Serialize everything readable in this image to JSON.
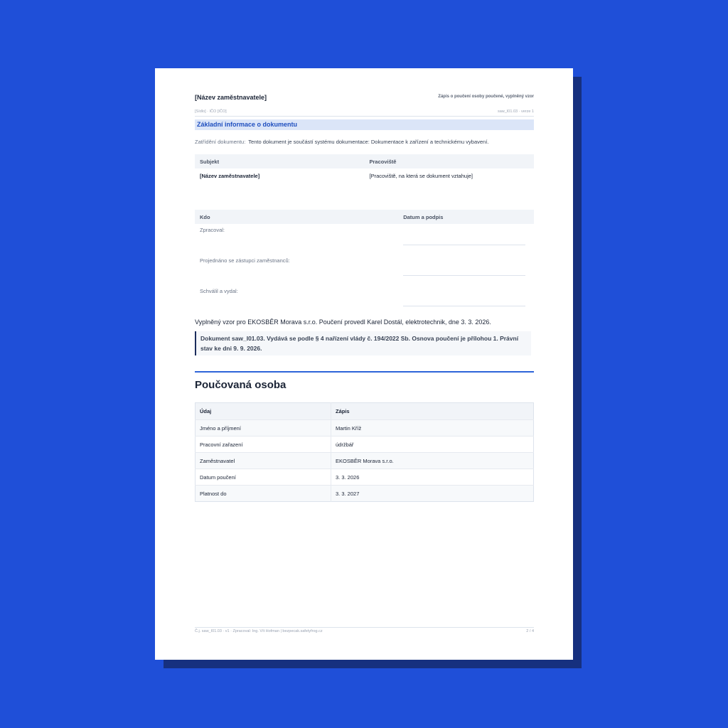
{
  "header": {
    "company": "[Název zaměstnavatele]",
    "title": "Zápis o poučení osoby poučené, vyplněný vzor",
    "sub_left": "[Sídlo] · IČO [IČO]",
    "sub_right": "saw_I01.03 · verze 1"
  },
  "section": {
    "title": "Základní informace o dokumentu",
    "classification_label": "Zatřídění dokumentu:",
    "classification_value": "Tento dokument je součástí systému dokumentace: Dokumentace k zařízení a technickému vybavení."
  },
  "subject_table": {
    "headers": [
      "Subjekt",
      "Pracoviště"
    ],
    "row": [
      "[Název zaměstnavatele]",
      "[Pracoviště, na která se dokument vztahuje]"
    ]
  },
  "sign_table": {
    "headers": [
      "Kdo",
      "Datum a podpis"
    ],
    "rows": [
      "Zpracoval:",
      "Projednáno se zástupci zaměstnanců:",
      "Schválil a vydal:"
    ]
  },
  "filled_note": "Vyplněný vzor pro EKOSBĚR Morava s.r.o. Poučení provedl Karel Dostál, elektrotechnik, dne 3. 3. 2026.",
  "legal_note": "Dokument saw_I01.03. Vydává se podle § 4 nařízení vlády č. 194/2022 Sb. Osnova poučení je přílohou 1. Právní stav ke dni 9. 9. 2026.",
  "person_section": {
    "heading": "Poučovaná osoba",
    "headers": [
      "Údaj",
      "Zápis"
    ],
    "rows": [
      [
        "Jméno a příjmení",
        "Martin Kříž"
      ],
      [
        "Pracovní zařazení",
        "údržbář"
      ],
      [
        "Zaměstnavatel",
        "EKOSBĚR Morava s.r.o."
      ],
      [
        "Datum poučení",
        "3. 3. 2026"
      ],
      [
        "Platnost do",
        "3. 3. 2027"
      ]
    ]
  },
  "footer": {
    "left": "Č.j. saw_I01.03 · v1 · Zpracoval: Ing. Vít Hofman | bezpecak.safetyfrog.cz",
    "right": "2 / 4"
  },
  "colors": {
    "background": "#1f4fd8",
    "accent": "#2d64d8",
    "section_bar": "#dbe5f8"
  }
}
